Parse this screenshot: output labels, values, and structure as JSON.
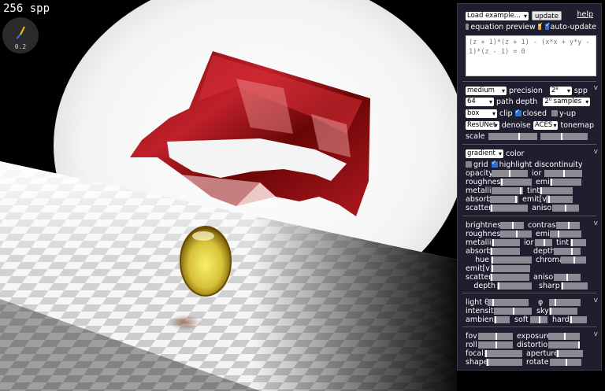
{
  "status": {
    "spp_label": "256 spp",
    "gizmo_value": "0.2"
  },
  "toolbar": {
    "load_example": "Load example...",
    "update": "update",
    "help": "help"
  },
  "options": {
    "equation_preview": "equation preview",
    "auto_update": "auto-update"
  },
  "equation": "(z + 1)*(z + 1) - (x*x + y*y - 1)*(z - 1) = 0",
  "render": {
    "precision_value": "medium",
    "precision_label": "precision",
    "spp_value": "2⁸",
    "spp_label": "spp",
    "depth_value": "64",
    "depth_label": "path depth",
    "samples_value": "2⁰ samples",
    "clip_value": "box",
    "clip_label": "clip",
    "closed_label": "closed",
    "yup_label": "y-up",
    "denoise_value": "ResUNet",
    "denoise_label": "denoise",
    "tonemap_value": "ACES",
    "tonemap_label": "tonemap",
    "scale_label": "scale"
  },
  "material": {
    "color_value": "gradient",
    "color_label": "color",
    "grid_label": "grid",
    "highlight_label": "highlight discontinuity",
    "opacity": "opacity",
    "ior": "ior",
    "roughness": "roughness",
    "emit": "emit",
    "metallic": "metallic",
    "tint": "tint",
    "absorb": "absorb",
    "emit_v": "emit[v]",
    "scatter": "scatter",
    "aniso": "aniso"
  },
  "background": {
    "brightness": "brightness",
    "contrast": "contrast",
    "roughness": "roughness",
    "emit": "emit",
    "metallic": "metallic",
    "ior": "ior",
    "tint": "tint",
    "absorb": "absorb",
    "depth": "depth",
    "hue": "hue",
    "chroma": "chroma",
    "emit_v": "emit[v]",
    "scatter": "scatter",
    "aniso": "aniso",
    "depth2": "depth",
    "sharp": "sharp"
  },
  "light": {
    "theta": "light θ",
    "phi": "φ",
    "intensity": "intensity",
    "sky": "sky",
    "ambient": "ambient",
    "soft": "soft",
    "hard": "hard"
  },
  "camera": {
    "fov": "fov",
    "exposure": "exposure",
    "roll": "roll",
    "distortion": "distortion",
    "focal": "focal",
    "aperture": "aperture",
    "shape": "shape",
    "rotate": "rotate"
  },
  "section_toggle": "v"
}
